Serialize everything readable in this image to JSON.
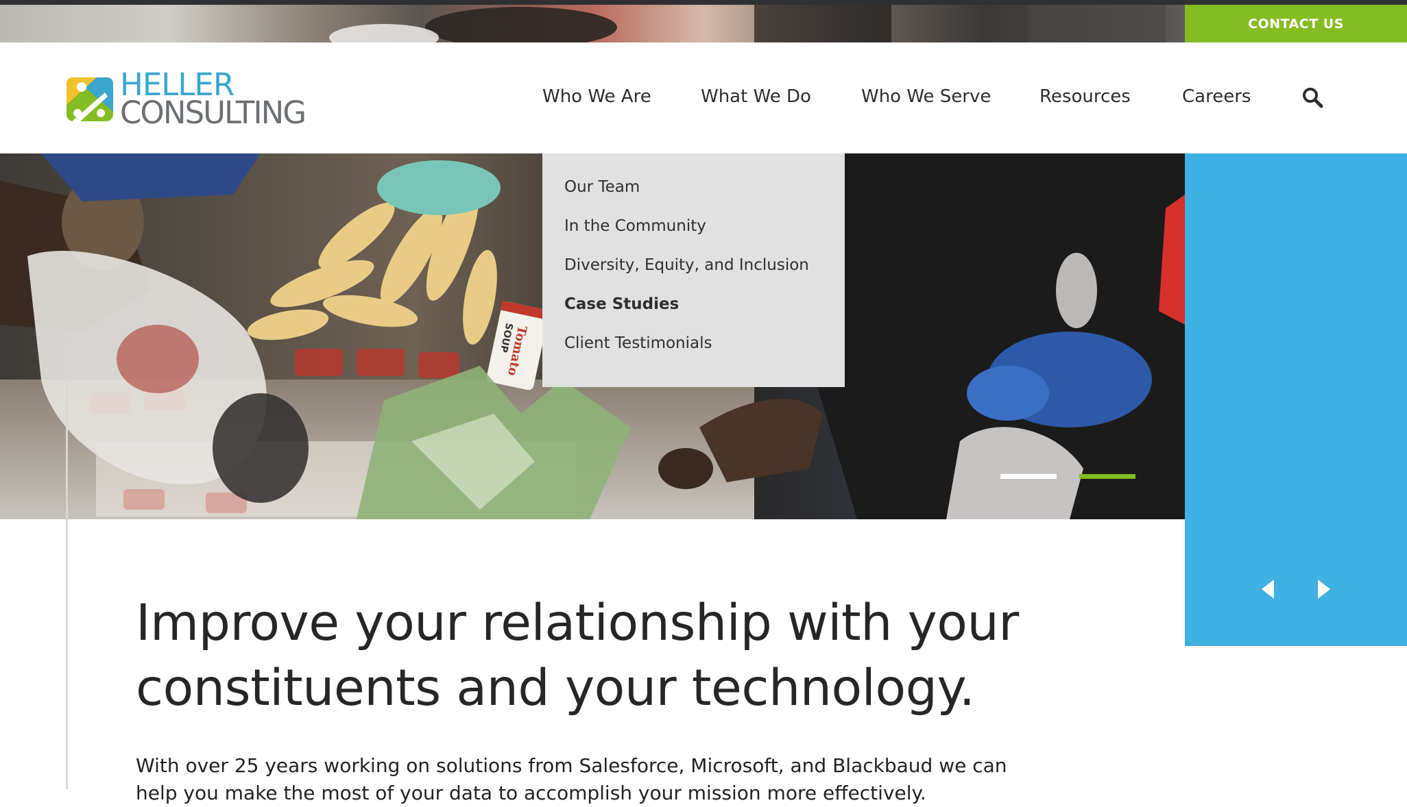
{
  "topbar": {
    "contact_label": "CONTACT US"
  },
  "logo": {
    "line1": "HELLER",
    "line2": "CONSULTING",
    "colors": {
      "yellow": "#f2c12e",
      "green": "#84bd22",
      "blue": "#3aa6d0",
      "text_blue": "#3aa6d0",
      "text_gray": "#6c6f73"
    }
  },
  "nav": {
    "items": [
      {
        "label": "Who We Are"
      },
      {
        "label": "What We Do"
      },
      {
        "label": "Who We Serve"
      },
      {
        "label": "Resources"
      },
      {
        "label": "Careers"
      }
    ],
    "search_icon": "search-icon"
  },
  "dropdown": {
    "items": [
      {
        "label": "Our Team",
        "active": false
      },
      {
        "label": "In the Community",
        "active": false
      },
      {
        "label": "Diversity, Equity, and Inclusion",
        "active": false
      },
      {
        "label": "Case Studies",
        "active": true
      },
      {
        "label": "Client Testimonials",
        "active": false
      }
    ]
  },
  "hero": {
    "slides": [
      {
        "state": "inactive",
        "color": "#ffffff"
      },
      {
        "state": "active",
        "color": "#84bd22"
      }
    ],
    "can_label": "Tomato",
    "can_sublabel": "SOUP"
  },
  "side_panel": {
    "color": "#3eb0e4",
    "prev_icon": "caret-left-icon",
    "next_icon": "caret-right-icon"
  },
  "main": {
    "headline": "Improve your relationship with your constituents and your technology.",
    "intro": "With over 25 years working on solutions from Salesforce, Microsoft, and Blackbaud we can help you make the most of your data to accomplish your mission more effectively."
  },
  "colors": {
    "accent_green": "#84bd22",
    "accent_blue": "#3eb0e4",
    "dropdown_bg": "#e1e1e1",
    "text": "#262626"
  }
}
